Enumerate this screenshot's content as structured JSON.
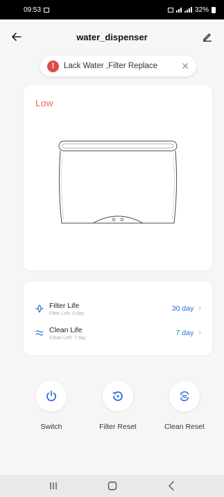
{
  "status_bar": {
    "time": "09:53",
    "battery": "32%"
  },
  "header": {
    "title": "water_dispenser",
    "back_icon": "arrow-left-icon",
    "edit_icon": "pencil-icon"
  },
  "alert": {
    "text": "Lack Water ,Filter Replace",
    "icon": "exclamation-icon",
    "close_icon": "close-icon"
  },
  "device": {
    "water_level": "Low",
    "level_color": "#ef6f61"
  },
  "life": {
    "filter": {
      "title": "Filter Life",
      "subtitle": "Filter Left: 0 day",
      "value": "30 day",
      "icon": "filter-icon"
    },
    "clean": {
      "title": "Clean Life",
      "subtitle": "Clean Left: 7 day",
      "value": "7 day",
      "icon": "clean-icon"
    },
    "value_color": "#2a6fd6"
  },
  "actions": [
    {
      "label": "Switch",
      "icon": "power-icon"
    },
    {
      "label": "Filter Reset",
      "icon": "reset-icon"
    },
    {
      "label": "Clean Reset",
      "icon": "clean-reset-icon"
    }
  ],
  "accent_color": "#2a6fd6"
}
